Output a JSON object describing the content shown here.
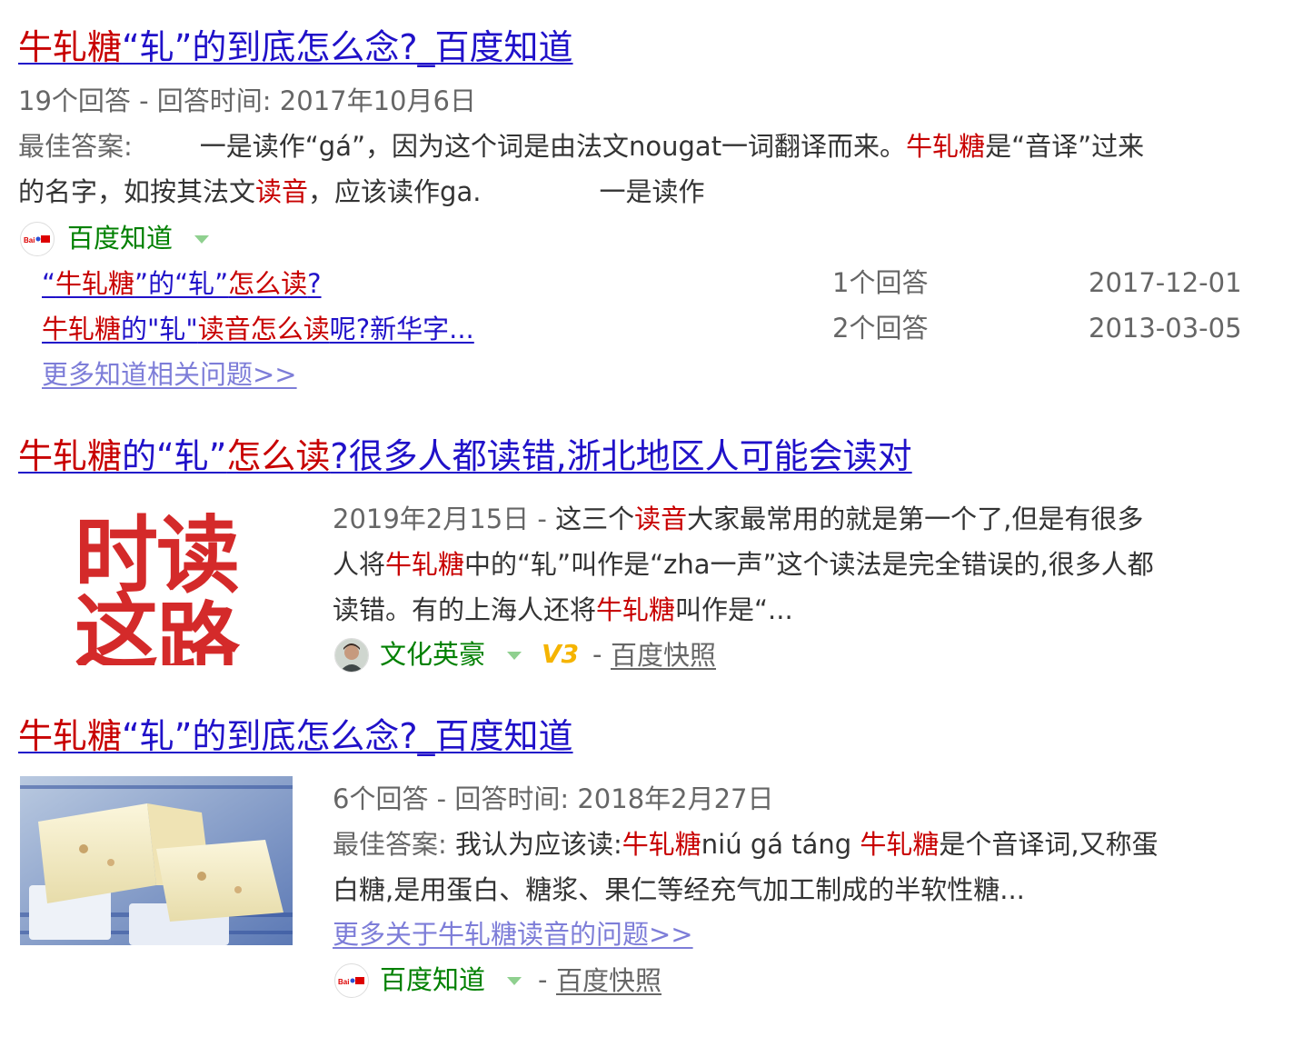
{
  "results": [
    {
      "title_parts": [
        "牛轧糖",
        "“轧”的到底怎么念?_百度知道"
      ],
      "meta": "19个回答 - 回答时间: 2017年10月6日",
      "answer_label": "最佳答案:",
      "answer_line1_a": "一是读作“gá”，因为这个词是由法文nougat一词翻译而来。",
      "answer_line1_b": "牛轧糖",
      "answer_line1_c": "是“音译”过来",
      "answer_line2_a": "的名字，如按其法文",
      "answer_line2_b": "读音",
      "answer_line2_c": "，应该读作ga.",
      "answer_line2_d": "一是读作",
      "source": "百度知道",
      "related": [
        {
          "title_parts": [
            "“",
            "牛轧糖",
            "”的“轧”",
            "怎么读",
            "?"
          ],
          "count": "1个回答",
          "date": "2017-12-01"
        },
        {
          "title_parts": [
            "牛轧糖",
            "的\"轧\"",
            "读音怎么读",
            "呢?新华字..."
          ],
          "count": "2个回答",
          "date": "2013-03-05"
        }
      ],
      "more": "更多知道相关问题>>"
    },
    {
      "title_parts": [
        "牛轧糖",
        "的“轧”",
        "怎么读",
        "?很多人都读错,浙北地区人可能会读对"
      ],
      "date": "2019年2月15日",
      "dash": "-",
      "line1_a": "这三个",
      "line1_b": "读音",
      "line1_c": "大家最常用的就是第一个了,但是有很多",
      "line2_a": "人将",
      "line2_b": "牛轧糖",
      "line2_c": "中的“轧”叫作是“zha一声”这个读法是完全错误的,很多人都",
      "line3_a": "读错。有的上海人还将",
      "line3_b": "牛轧糖",
      "line3_c": "叫作是“...",
      "thumb_chars": [
        "时",
        "这",
        "读",
        "路"
      ],
      "source": "文化英豪",
      "level_badge": "V3",
      "separator": "-",
      "snapshot": "百度快照"
    },
    {
      "title_parts": [
        "牛轧糖",
        "“轧”的到底怎么念?_百度知道"
      ],
      "meta": "6个回答 - 回答时间: 2018年2月27日",
      "line1_label": "最佳答案:",
      "line1_a": "我认为应该读:",
      "line1_b": "牛轧糖",
      "line1_c": "niú gá táng",
      "line1_d": "牛轧糖",
      "line1_e": "是个音译词,又称蛋",
      "line2": "白糖,是用蛋白、糖浆、果仁等经充气加工制成的半软性糖...",
      "more": "更多关于牛轧糖读音的问题>>",
      "source": "百度知道",
      "separator": "-",
      "snapshot": "百度快照"
    }
  ],
  "source_icon_text": "Bai知道",
  "colors": {
    "title_blue": "#2011c9",
    "highlight_red": "#c80000",
    "source_green": "#008000",
    "more_link": "#7d7dd8"
  }
}
